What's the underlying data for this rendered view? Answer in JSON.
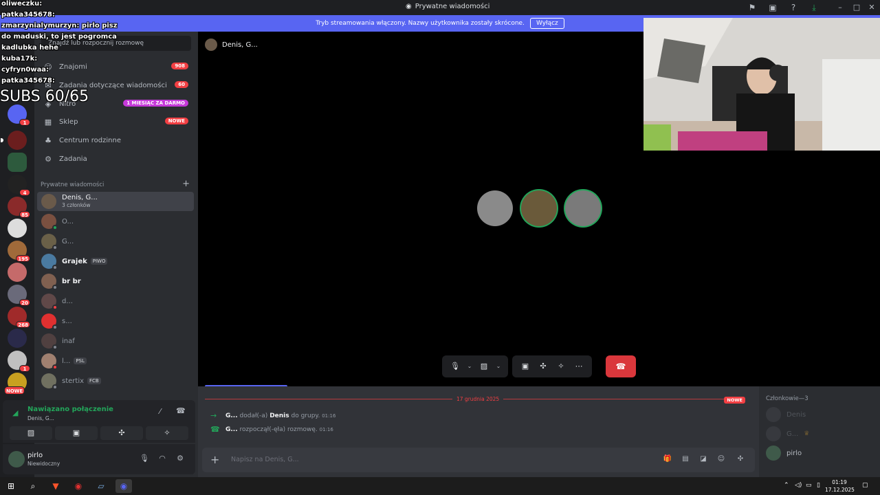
{
  "window": {
    "title": "Prywatne wiadomości"
  },
  "banner": {
    "text": "Tryb streamowania włączony. Nazwy użytkownika zostały skrócone.",
    "button": "Wyłącz"
  },
  "overlay": {
    "lines": [
      {
        "user": "oliweczku:",
        "msg": ""
      },
      {
        "user": "patka345678:",
        "msg": ""
      },
      {
        "user": "zmarzynialymurzyn:",
        "msg": "pirlo pisz"
      },
      {
        "user": "",
        "msg": "do maduski, to jest pogromca"
      },
      {
        "user": "",
        "msg": "kadlubka hehe"
      },
      {
        "user": "kuba17k:",
        "msg": ""
      },
      {
        "user": "cyfryn0waa:",
        "msg": ""
      },
      {
        "user": "patka345678:",
        "msg": ""
      }
    ],
    "subs": "SUBS 60/65"
  },
  "rail": {
    "badges": [
      "1",
      "60",
      "",
      "4",
      "85",
      "",
      "195",
      "20",
      "268",
      "",
      "1",
      "NOWE"
    ]
  },
  "sidebar": {
    "search_placeholder": "Znajdź lub rozpocznij rozmowę",
    "nav": [
      {
        "label": "Znajomi",
        "badge": "908",
        "icon": "friends-icon"
      },
      {
        "label": "Zadania dotyczące wiadomości",
        "badge": "60",
        "icon": "message-requests-icon"
      },
      {
        "label": "Nitro",
        "badge": "1 MIESIĄC ZA DARMO",
        "icon": "nitro-icon"
      },
      {
        "label": "Sklep",
        "badge": "NOWE",
        "icon": "shop-icon"
      },
      {
        "label": "Centrum rodzinne",
        "badge": "",
        "icon": "family-icon"
      },
      {
        "label": "Zadania",
        "badge": "",
        "icon": "quests-icon"
      }
    ],
    "dm_header": "Prywatne wiadomości",
    "dms": [
      {
        "name": "Denis, G...",
        "sub": "3 członków"
      },
      {
        "name": "O...",
        "sub": ""
      },
      {
        "name": "G...",
        "sub": ""
      },
      {
        "name": "Grajek",
        "sub": "",
        "tag": "PIWO"
      },
      {
        "name": "br br",
        "sub": ""
      },
      {
        "name": "d...",
        "sub": ""
      },
      {
        "name": "s...",
        "sub": ""
      },
      {
        "name": "inaf",
        "sub": ""
      },
      {
        "name": "l...",
        "sub": "",
        "tag": "PSL"
      },
      {
        "name": "stertix",
        "sub": "",
        "tag": "FCB"
      }
    ]
  },
  "voice": {
    "status": "Nawiązano połączenie",
    "channel": "Denis, G..."
  },
  "user": {
    "name": "pirlo",
    "status": "Niewidoczny"
  },
  "main": {
    "dm_title": "Denis, G...",
    "divider_date": "17 grudnia 2025",
    "divider_new": "NOWE",
    "messages": [
      {
        "actor": "G...",
        "text1": "dodał(-a)",
        "target": "Denis",
        "text2": "do grupy.",
        "time": "01:16"
      },
      {
        "actor": "G...",
        "text1": "rozpoczął(-ęła) rozmowę.",
        "target": "",
        "text2": "",
        "time": "01:16"
      }
    ],
    "composer_placeholder": "Napisz na Denis, G..."
  },
  "members": {
    "header": "Członkowie—3",
    "list": [
      {
        "name": "Denis"
      },
      {
        "name": "G..."
      },
      {
        "name": "pirlo"
      }
    ]
  },
  "taskbar": {
    "time": "01:19",
    "date": "17.12.2025"
  },
  "colors": {
    "accent": "#5865f2",
    "online": "#23a55a",
    "danger": "#f23f43"
  }
}
